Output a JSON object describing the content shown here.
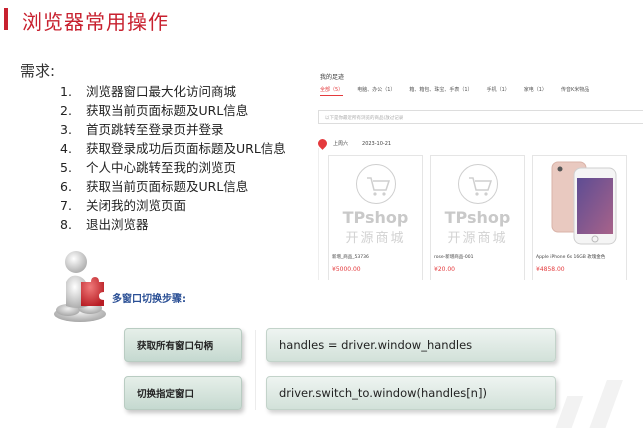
{
  "header": {
    "title": "浏览器常用操作"
  },
  "requirements": {
    "label": "需求:",
    "items": [
      {
        "num": "1.",
        "text": "浏览器窗口最大化访问商城"
      },
      {
        "num": "2.",
        "text": "获取当前页面标题及URL信息"
      },
      {
        "num": "3.",
        "text": "首页跳转至登录页并登录"
      },
      {
        "num": "4.",
        "text": "获取登录成功后页面标题及URL信息"
      },
      {
        "num": "5.",
        "text": "个人中心跳转至我的浏览页"
      },
      {
        "num": "6.",
        "text": "获取当前页面标题及URL信息"
      },
      {
        "num": "7.",
        "text": "关闭我的浏览页面"
      },
      {
        "num": "8.",
        "text": "退出浏览器"
      }
    ]
  },
  "shop": {
    "title": "我的足迹",
    "tabs": [
      "全部（5）",
      "电脑、办公（1）",
      "箱、箱包、珠宝、手表（1）",
      "手机（1）",
      "家电（1）",
      "传音K米物品"
    ],
    "search_placeholder": "以下是你最近所有浏览的商品(放过记录",
    "date_day": "上周六",
    "date": "2023-10-21",
    "products": [
      {
        "name": "新增_商品_53736",
        "price": "¥5000.00",
        "watermark_top": "TPshop",
        "watermark_bottom": "开源商城"
      },
      {
        "name": "rose-新增商品-001",
        "price": "¥20.00",
        "watermark_top": "TPshop",
        "watermark_bottom": "开源商城"
      },
      {
        "name": "Apple iPhone 6s 16GB 玫瑰金色",
        "price": "¥4858.00"
      }
    ]
  },
  "steps": {
    "title": "多窗口切换步骤:",
    "items": [
      {
        "label": "获取所有窗口句柄",
        "code": "handles = driver.window_handles"
      },
      {
        "label": "切换指定窗口",
        "code": "driver.switch_to.window(handles[n])"
      }
    ]
  },
  "colors": {
    "accent": "#c8212f",
    "price": "#e43a3d",
    "steps_title": "#2a4f95",
    "button_bg": "#d6e5dd"
  }
}
